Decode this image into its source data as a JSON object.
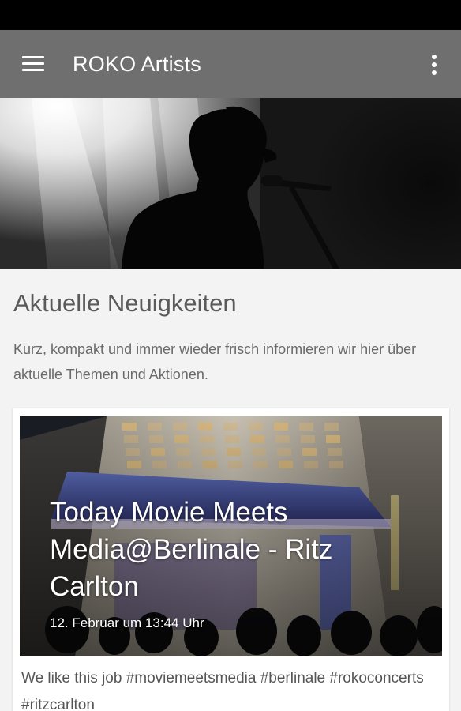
{
  "app_bar": {
    "title": "ROKO Artists",
    "menu_icon": "hamburger-menu-icon",
    "overflow_icon": "more-vert-icon",
    "background_color": "#6f6f6f"
  },
  "hero": {
    "image": "singer-silhouette-spotlight"
  },
  "section": {
    "title": "Aktuelle Neuigkeiten",
    "description": "Kurz, kompakt und immer wieder frisch informieren wir hier über aktuelle Themen und Aktionen."
  },
  "news": [
    {
      "title": "Today Movie Meets Media@Berlinale - Ritz Carlton",
      "date": "12. Februar um 13:44 Uhr",
      "text": "We like this job #moviemeetsmedia #berlinale #rokoconcerts #ritzcarlton",
      "image": "ritz-carlton-night-facade"
    }
  ]
}
